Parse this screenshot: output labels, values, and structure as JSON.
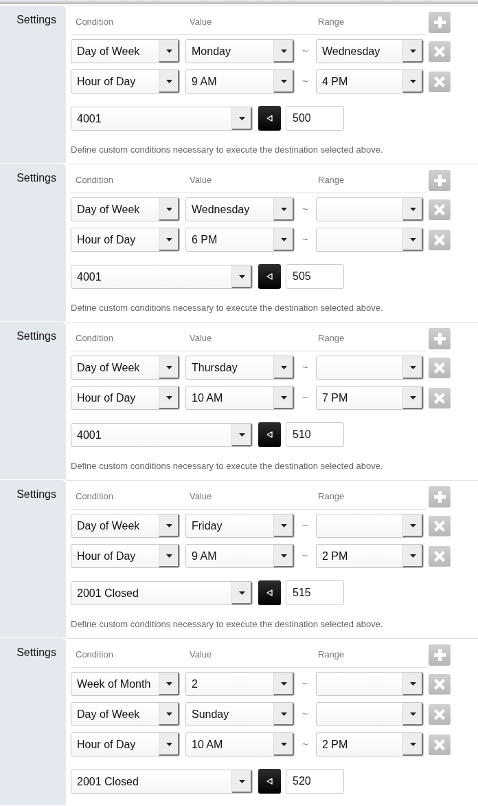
{
  "sections": [
    {
      "label": "Settings",
      "columns": [
        "Condition",
        "Value",
        "Range"
      ],
      "conditions": [
        {
          "condition": "Day of Week",
          "value": "Monday",
          "separator": "~",
          "range": "Wednesday"
        },
        {
          "condition": "Hour of Day",
          "value": "9 AM",
          "separator": "~",
          "range": "4 PM"
        }
      ],
      "destination": {
        "target": "4001",
        "number": "500"
      },
      "help": "Define custom conditions necessary to execute the destination selected above."
    },
    {
      "label": "Settings",
      "columns": [
        "Condition",
        "Value",
        "Range"
      ],
      "conditions": [
        {
          "condition": "Day of Week",
          "value": "Wednesday",
          "separator": "~"
        },
        {
          "condition": "Hour of Day",
          "value": "6 PM",
          "separator": "~"
        }
      ],
      "destination": {
        "target": "4001",
        "number": "505"
      },
      "help": "Define custom conditions necessary to execute the destination selected above."
    },
    {
      "label": "Settings",
      "columns": [
        "Condition",
        "Value",
        "Range"
      ],
      "conditions": [
        {
          "condition": "Day of Week",
          "value": "Thursday",
          "separator": "~"
        },
        {
          "condition": "Hour of Day",
          "value": "10 AM",
          "separator": "~",
          "range": "7 PM"
        }
      ],
      "destination": {
        "target": "4001",
        "number": "510"
      },
      "help": "Define custom conditions necessary to execute the destination selected above."
    },
    {
      "label": "Settings",
      "columns": [
        "Condition",
        "Value",
        "Range"
      ],
      "conditions": [
        {
          "condition": "Day of Week",
          "value": "Friday",
          "separator": "~"
        },
        {
          "condition": "Hour of Day",
          "value": "9 AM",
          "separator": "~",
          "range": "2 PM"
        }
      ],
      "destination": {
        "target": "2001 Closed",
        "number": "515"
      },
      "help": "Define custom conditions necessary to execute the destination selected above."
    },
    {
      "label": "Settings",
      "columns": [
        "Condition",
        "Value",
        "Range"
      ],
      "conditions": [
        {
          "condition": "Week of Month",
          "value": "2",
          "separator": "~"
        },
        {
          "condition": "Day of Week",
          "value": "Sunday",
          "separator": "~"
        },
        {
          "condition": "Hour of Day",
          "value": "10 AM",
          "separator": "~",
          "range": "2 PM"
        }
      ],
      "destination": {
        "target": "2001 Closed",
        "number": "520"
      }
    }
  ]
}
